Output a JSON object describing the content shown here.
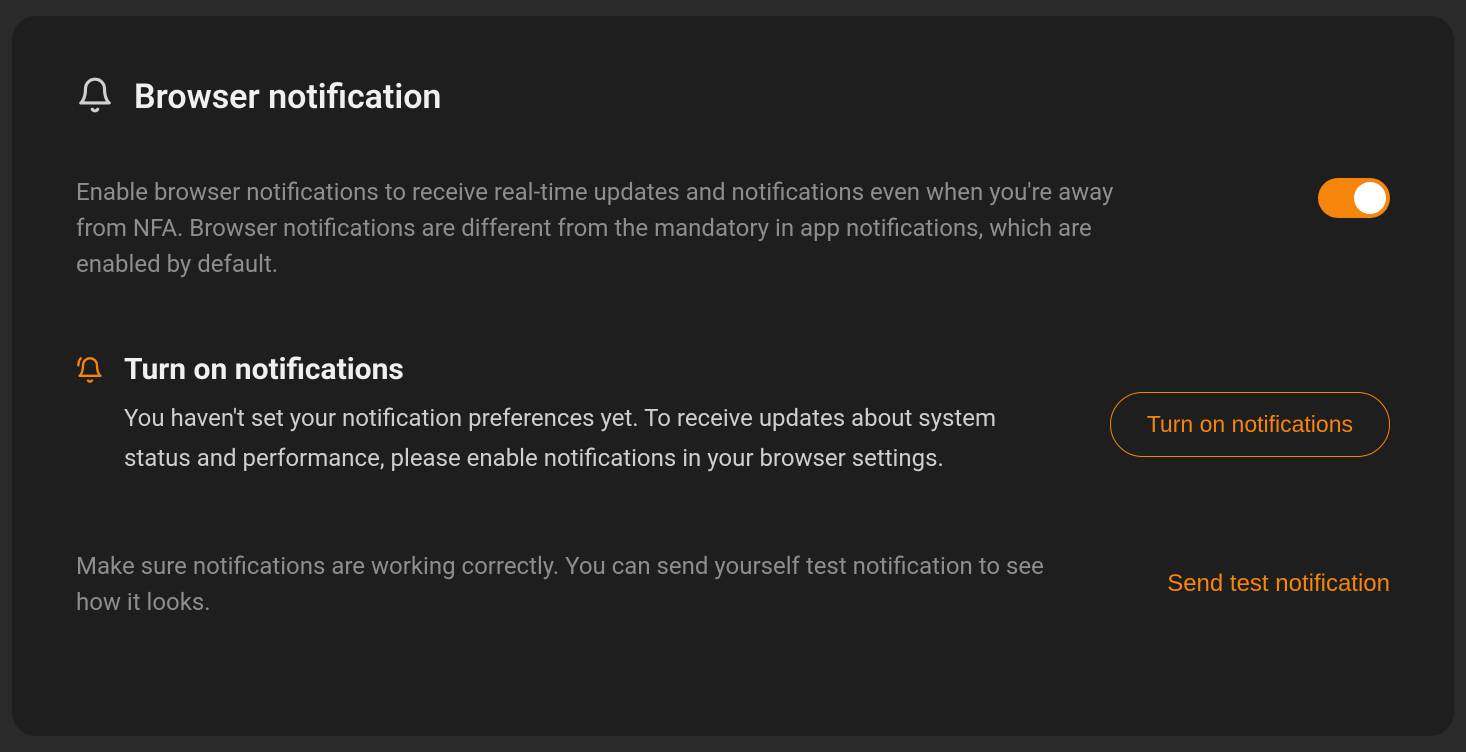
{
  "header": {
    "title": "Browser notification"
  },
  "main": {
    "description": "Enable browser notifications to receive real-time updates and notifications even when you're away from NFA. Browser notifications are different from the mandatory in app notifications, which are enabled by default.",
    "toggle_on": true
  },
  "turn_on": {
    "title": "Turn on notifications",
    "description": "You haven't set your notification preferences yet. To receive updates about system status and performance, please enable notifications in your browser settings.",
    "button_label": "Turn on notifications"
  },
  "test": {
    "description": "Make sure notifications are working correctly. You can send yourself test notification to see how it looks.",
    "button_label": "Send test notification"
  },
  "colors": {
    "accent": "#f5850b",
    "bg_card": "#1e1e1e",
    "bg_page": "#2a2a2a",
    "text_primary": "#f0f0f0",
    "text_secondary": "#8e8e8e"
  }
}
